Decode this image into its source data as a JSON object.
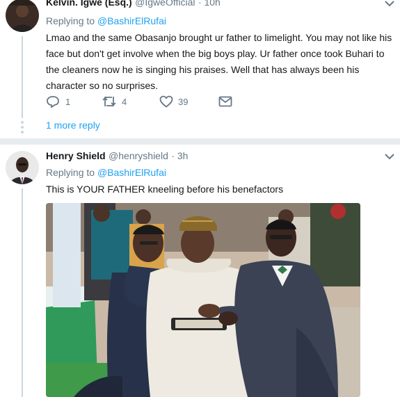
{
  "tweet1": {
    "name": "Kelvin. Igwe (Esq.)",
    "handle": "@IgweOfficial",
    "time": "· 10h",
    "replying_label": "Replying to",
    "replying_to": "@BashirElRufai",
    "text": "Lmao and the same Obasanjo brought ur father to limelight. You may not like his face but don't get involve when the big boys play. Ur father once took Buhari to the cleaners now he is singing his praises. Well that has always been his character so no surprises.",
    "replies": "1",
    "retweets": "4",
    "likes": "39",
    "more_replies": "1 more reply"
  },
  "tweet2": {
    "name": "Henry Shield",
    "handle": "@henryshield",
    "time": "· 3h",
    "replying_label": "Replying to",
    "replying_to": "@BashirElRufai",
    "text": "This is YOUR FATHER kneeling before his benefactors"
  },
  "icons": [
    "reply-icon",
    "retweet-icon",
    "like-icon",
    "direct-message-icon",
    "chevron-down-icon"
  ],
  "colors": {
    "link": "#1da1f2",
    "muted": "#657786",
    "line": "#ccd6dd",
    "separator": "#e6ecf0"
  }
}
